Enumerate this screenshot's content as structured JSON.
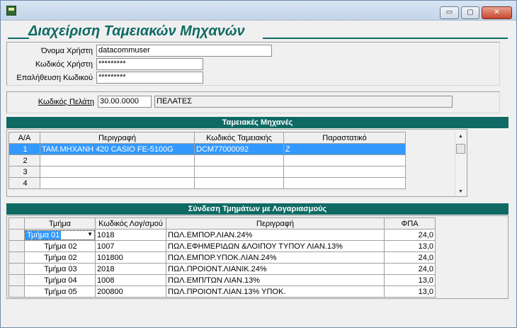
{
  "title": "Διαχείριση Ταμειακών Μηχανών",
  "window_buttons": {
    "minimize": "▭",
    "maximize": "▢",
    "close": "✕"
  },
  "login": {
    "username_label": "Όνομα Χρήστη",
    "username_value": "datacommuser",
    "password_label": "Κωδικός Χρήστη",
    "password_value": "*********",
    "confirm_label": "Επαλήθευση Κωδικού",
    "confirm_value": "*********"
  },
  "customer": {
    "label": "Κωδικός Πελάτη",
    "code": "30.00.0000",
    "name": "ΠΕΛΑΤΕΣ"
  },
  "machines": {
    "title": "Ταμειακές Μηχανές",
    "headers": [
      "Α/Α",
      "Περιγραφή",
      "Κωδικός Ταμειακής",
      "Παραστατικό"
    ],
    "rows": [
      [
        "1",
        "ΤΑΜ.ΜΗΧΑΝΗ 420 CASIO FE-5100G",
        "DCM77000092",
        "Z"
      ],
      [
        "2",
        "",
        "",
        ""
      ],
      [
        "3",
        "",
        "",
        ""
      ],
      [
        "4",
        "",
        "",
        ""
      ]
    ]
  },
  "departments": {
    "title": "Σύνδεση Τμημάτων με Λογαριασμούς",
    "headers": [
      "Τμήμα",
      "Κωδικός Λογ/σμού",
      "Περιγραφή",
      "ΦΠΑ"
    ],
    "rows": [
      [
        "Τμήμα 01",
        "1018",
        "ΠΩΛ.ΕΜΠΟΡ.ΛΙΑΝ.24%",
        "24,0"
      ],
      [
        "Τμήμα 02",
        "1007",
        "ΠΩΛ.ΕΦΗΜΕΡΙΔΩΝ &ΛΟΙΠΟΥ ΤΥΠΟΥ ΛΙΑΝ.13%",
        "13,0"
      ],
      [
        "Τμήμα 02",
        "101800",
        "ΠΩΛ.ΕΜΠΟΡ.ΥΠΟΚ.ΛΙΑΝ.24%",
        "24,0"
      ],
      [
        "Τμήμα 03",
        "2018",
        "ΠΩΛ.ΠΡΟΙΟΝΤ.ΛΙΑΝΙΚ.24%",
        "24,0"
      ],
      [
        "Τμήμα 04",
        "1008",
        "ΠΩΛ.ΕΜΠ/ΤΩΝ ΛΙΑΝ.13%",
        "13,0"
      ],
      [
        "Τμήμα 05",
        "200800",
        "ΠΩΛ.ΠΡΟΙΟΝΤ.ΛΙΑΝ.13% ΥΠΟΚ.",
        "13,0"
      ]
    ]
  }
}
